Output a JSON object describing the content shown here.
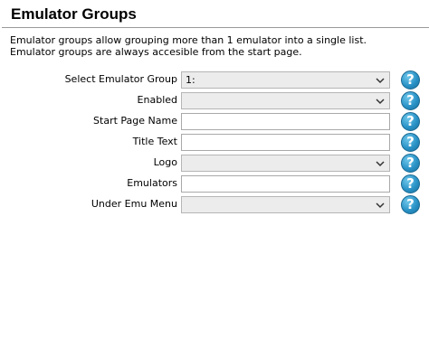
{
  "header": {
    "title": "Emulator Groups"
  },
  "description": {
    "line1": "Emulator groups allow grouping more than 1 emulator into a single list.",
    "line2": "Emulator groups are always accesible from the start page."
  },
  "help_glyph": "?",
  "form": {
    "rows": [
      {
        "label": "Select Emulator Group",
        "type": "select",
        "value": "1:"
      },
      {
        "label": "Enabled",
        "type": "select",
        "value": ""
      },
      {
        "label": "Start Page Name",
        "type": "text",
        "value": ""
      },
      {
        "label": "Title Text",
        "type": "text",
        "value": ""
      },
      {
        "label": "Logo",
        "type": "select",
        "value": ""
      },
      {
        "label": "Emulators",
        "type": "text",
        "value": ""
      },
      {
        "label": "Under Emu Menu",
        "type": "select",
        "value": ""
      }
    ]
  },
  "icons": {
    "dropdown": "chevron-down-icon",
    "help": "help-icon"
  },
  "colors": {
    "help_icon": "#2a93c7",
    "select_bg": "#ececec"
  }
}
